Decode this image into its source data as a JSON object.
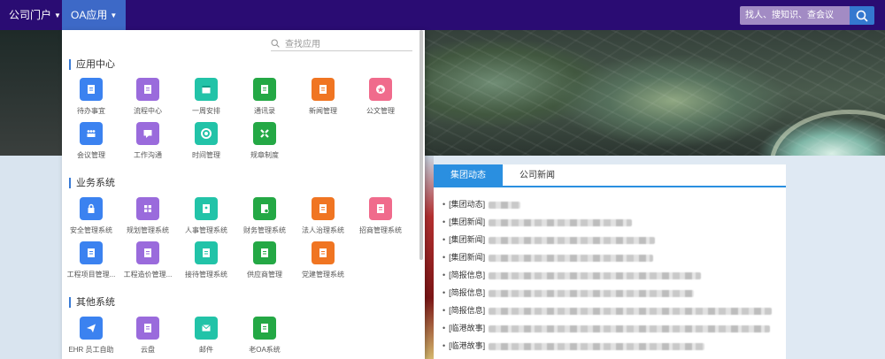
{
  "topnav": {
    "items": [
      {
        "label": "公司门户"
      },
      {
        "label": "OA应用"
      }
    ],
    "search_placeholder": "找人、搜知识、查会议"
  },
  "dropdown": {
    "search_placeholder": "查找应用",
    "sections": [
      {
        "title": "应用中心",
        "apps": [
          {
            "label": "待办事宜",
            "color": "#3b82f0",
            "icon": "clipboard-icon"
          },
          {
            "label": "流程中心",
            "color": "#9a6bdc",
            "icon": "document-icon"
          },
          {
            "label": "一周安排",
            "color": "#22c3a8",
            "icon": "calendar-icon"
          },
          {
            "label": "通讯录",
            "color": "#24a845",
            "icon": "contacts-icon"
          },
          {
            "label": "新闻管理",
            "color": "#f07522",
            "icon": "news-icon"
          },
          {
            "label": "公文管理",
            "color": "#f06b8c",
            "icon": "stamp-icon"
          },
          {
            "label": "会议管理",
            "color": "#3b82f0",
            "icon": "meeting-icon"
          },
          {
            "label": "工作沟通",
            "color": "#9a6bdc",
            "icon": "chat-icon"
          },
          {
            "label": "时间管理",
            "color": "#22c3a8",
            "icon": "clock-icon"
          },
          {
            "label": "规章制度",
            "color": "#24a845",
            "icon": "rules-icon"
          }
        ]
      },
      {
        "title": "业务系统",
        "apps": [
          {
            "label": "安全管理系统",
            "color": "#3b82f0",
            "icon": "lock-icon"
          },
          {
            "label": "规划管理系统",
            "color": "#9a6bdc",
            "icon": "grid-icon"
          },
          {
            "label": "人事管理系统",
            "color": "#22c3a8",
            "icon": "person-icon"
          },
          {
            "label": "财务管理系统",
            "color": "#24a845",
            "icon": "finance-icon"
          },
          {
            "label": "法人治理系统",
            "color": "#f07522",
            "icon": "document-icon"
          },
          {
            "label": "招商管理系统",
            "color": "#f06b8c",
            "icon": "document-icon"
          },
          {
            "label": "工程项目管理...",
            "color": "#3b82f0",
            "icon": "document-icon"
          },
          {
            "label": "工程造价管理...",
            "color": "#9a6bdc",
            "icon": "document-icon"
          },
          {
            "label": "接待管理系统",
            "color": "#22c3a8",
            "icon": "document-icon"
          },
          {
            "label": "供应商管理",
            "color": "#24a845",
            "icon": "document-icon"
          },
          {
            "label": "党建管理系统",
            "color": "#f07522",
            "icon": "document-icon"
          }
        ]
      },
      {
        "title": "其他系统",
        "apps": [
          {
            "label": "EHR 员工自助",
            "color": "#3b82f0",
            "icon": "send-icon"
          },
          {
            "label": "云盘",
            "color": "#9a6bdc",
            "icon": "cloud-icon"
          },
          {
            "label": "邮件",
            "color": "#22c3a8",
            "icon": "mail-icon"
          },
          {
            "label": "老OA系统",
            "color": "#24a845",
            "icon": "document-icon"
          }
        ]
      }
    ]
  },
  "news": {
    "tabs": [
      {
        "label": "集团动态",
        "active": true
      },
      {
        "label": "公司新闻",
        "active": false
      }
    ],
    "rows": [
      {
        "tag": "[集团动态]"
      },
      {
        "tag": "[集团新闻]"
      },
      {
        "tag": "[集团新闻]"
      },
      {
        "tag": "[集团新闻]"
      },
      {
        "tag": "[简报信息]"
      },
      {
        "tag": "[简报信息]"
      },
      {
        "tag": "[简报信息]"
      },
      {
        "tag": "[临港故事]"
      },
      {
        "tag": "[临港故事]"
      }
    ]
  }
}
